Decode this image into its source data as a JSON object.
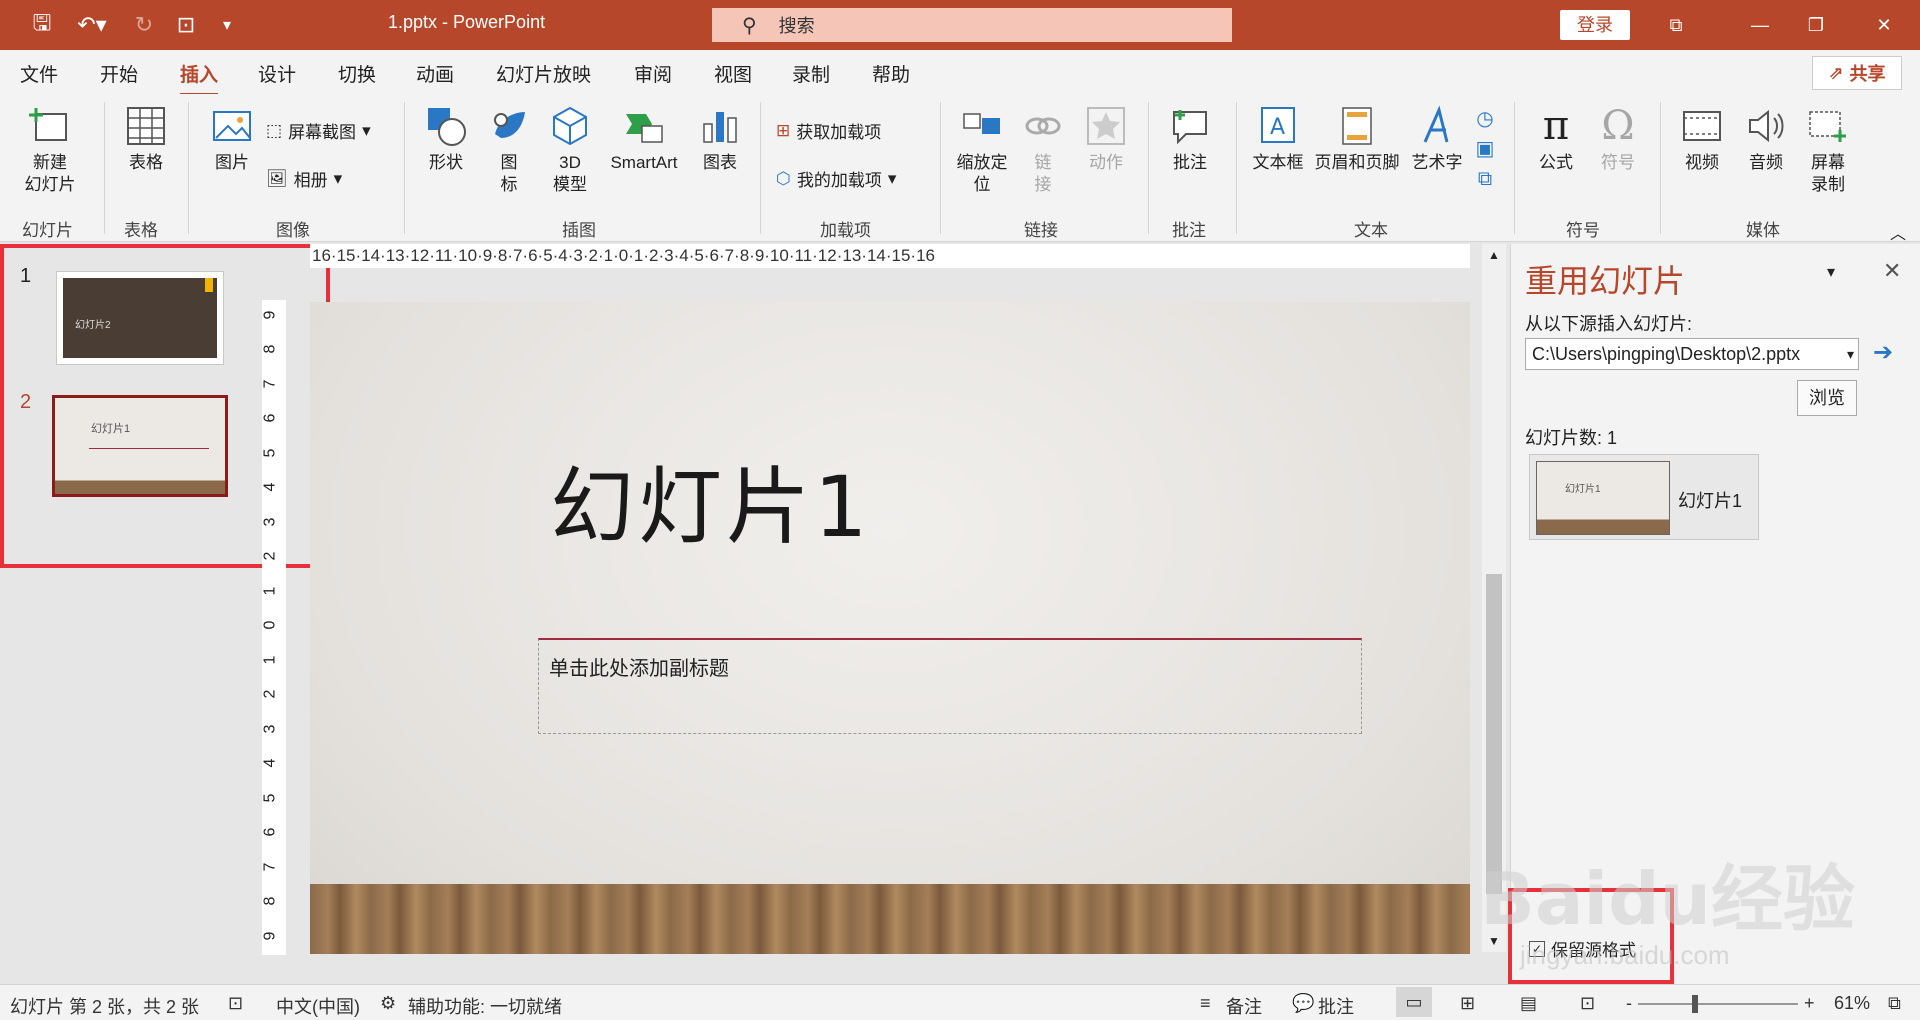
{
  "window": {
    "file_title": "1.pptx  -  PowerPoint",
    "search_label": "搜索",
    "login_label": "登录"
  },
  "menu": {
    "tabs": [
      "文件",
      "开始",
      "插入",
      "设计",
      "切换",
      "动画",
      "幻灯片放映",
      "审阅",
      "视图",
      "录制",
      "帮助"
    ],
    "active_tab": "插入",
    "share_label": "共享"
  },
  "ribbon": {
    "new_slide": "新建\n幻灯片",
    "table": "表格",
    "picture": "图片",
    "screenshot": "屏幕截图",
    "album": "相册",
    "shapes": "形状",
    "icons": "图\n标",
    "model3d": "3D\n模型",
    "smartart": "SmartArt",
    "chart": "图表",
    "get_addins": "获取加载项",
    "my_addins": "我的加载项",
    "zoom": "缩放定\n位",
    "link": "链\n接",
    "action": "动作",
    "comment": "批注",
    "textbox": "文本框",
    "header_footer": "页眉和页脚",
    "wordart": "艺术字",
    "equation": "公式",
    "symbol": "符号",
    "video": "视频",
    "audio": "音频",
    "screen_record": "屏幕\n录制",
    "groups": {
      "slides": "幻灯片",
      "tables": "表格",
      "images": "图像",
      "illustrations": "插图",
      "addins": "加载项",
      "links": "链接",
      "comments": "批注",
      "text": "文本",
      "symbols": "符号",
      "media": "媒体"
    }
  },
  "thumbnails": [
    {
      "number": "1",
      "text": "幻灯片2"
    },
    {
      "number": "2",
      "text": "幻灯片1"
    }
  ],
  "ruler": {
    "horizontal": "16·15·14·13·12·11·10·9·8·7·6·5·4·3·2·1·0·1·2·3·4·5·6·7·8·9·10·11·12·13·14·15·16",
    "vertical": [
      "9",
      "8",
      "7",
      "6",
      "5",
      "4",
      "3",
      "2",
      "1",
      "0",
      "1",
      "2",
      "3",
      "4",
      "5",
      "6",
      "7",
      "8",
      "9"
    ]
  },
  "slide": {
    "title": "幻灯片1",
    "subtitle_placeholder": "单击此处添加副标题"
  },
  "reuse_pane": {
    "title": "重用幻灯片",
    "source_label": "从以下源插入幻灯片:",
    "path_value": "C:\\Users\\pingping\\Desktop\\2.pptx",
    "browse_label": "浏览",
    "slide_count": "幻灯片数: 1",
    "item_label": "幻灯片1",
    "keep_format_label": "保留源格式",
    "keep_format_checked": true
  },
  "statusbar": {
    "slide_info": "幻灯片 第 2 张，共 2 张",
    "language": "中文(中国)",
    "accessibility": "辅助功能: 一切就绪",
    "notes": "备注",
    "comments": "批注",
    "zoom": "61%",
    "zoom_minus": "-",
    "zoom_plus": "+"
  },
  "watermark": {
    "brand": "Baidu经验",
    "url": "jingyan.baidu.com"
  },
  "colors": {
    "accent": "#b7472a",
    "highlight_box": "#e8303a"
  }
}
